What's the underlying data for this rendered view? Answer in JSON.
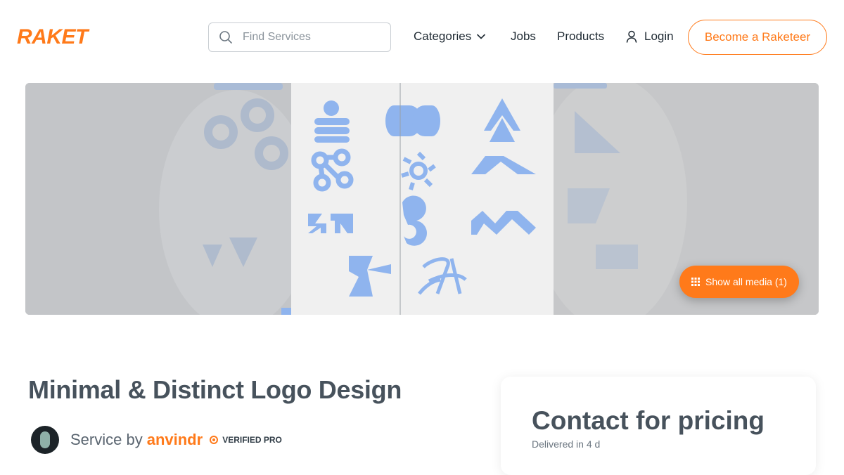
{
  "header": {
    "logo": "RAKET",
    "search_placeholder": "Find Services",
    "nav": {
      "categories": "Categories",
      "jobs": "Jobs",
      "products": "Products",
      "login": "Login"
    },
    "cta": "Become a Raketeer"
  },
  "media": {
    "show_all_label": "Show all media (1)"
  },
  "service": {
    "title": "Minimal & Distinct Logo Design",
    "service_by_label": "Service by",
    "seller_name": "anvindr",
    "badge": "VERIFIED PRO"
  },
  "pricing": {
    "title": "Contact for pricing",
    "delivery_text": "Delivered in 4 d"
  },
  "colors": {
    "brand": "#ff7a1a",
    "logo_blue": "#8fb4ee",
    "text_dark": "#47525c"
  },
  "icons": [
    "search-icon",
    "chevron-down-icon",
    "user-icon",
    "grid-icon",
    "verified-badge-icon"
  ]
}
